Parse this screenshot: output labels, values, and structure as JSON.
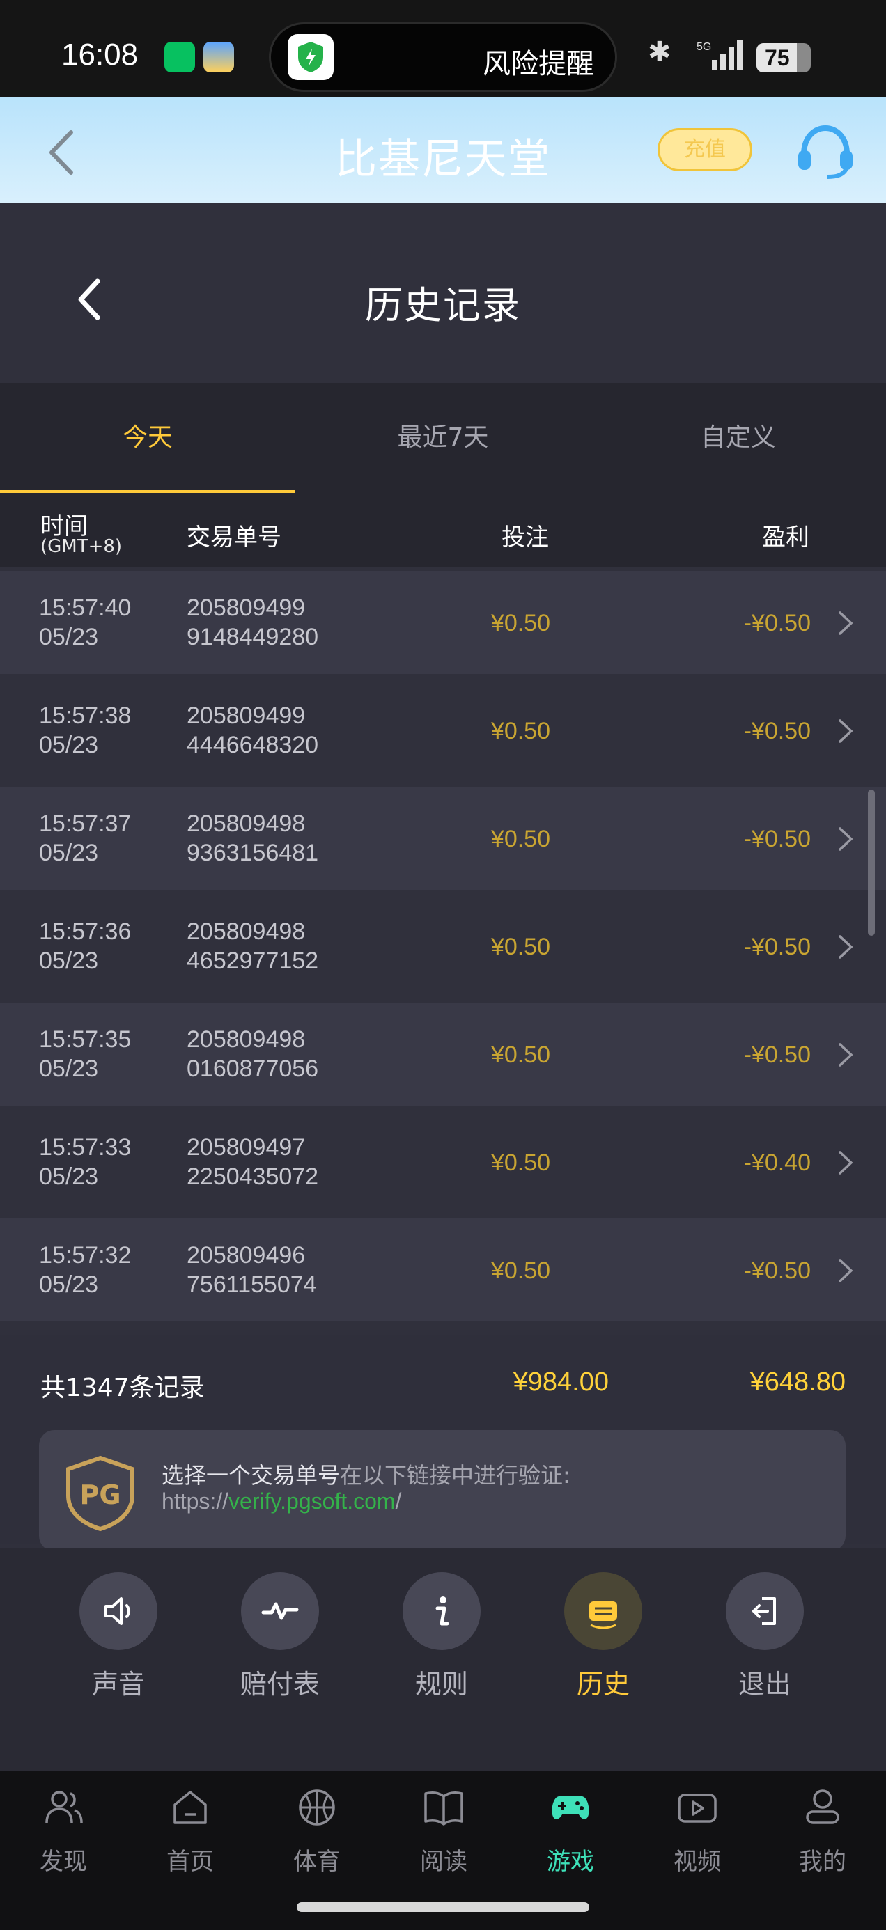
{
  "status_bar": {
    "time": "16:08",
    "risk_label": "风险提醒",
    "network": "5G",
    "battery": "75"
  },
  "header": {
    "title": "比基尼天堂",
    "recharge_label": "充值"
  },
  "history": {
    "title": "历史记录",
    "tabs": [
      "今天",
      "最近7天",
      "自定义"
    ],
    "active_tab": 0,
    "columns": {
      "time": "时间",
      "timezone": "(GMT+8)",
      "txn": "交易单号",
      "bet": "投注",
      "profit": "盈利"
    },
    "rows": [
      {
        "time": "15:57:40",
        "date": "05/23",
        "txn1": "205809499",
        "txn2": "9148449280",
        "bet": "¥0.50",
        "profit": "-¥0.50"
      },
      {
        "time": "15:57:38",
        "date": "05/23",
        "txn1": "205809499",
        "txn2": "4446648320",
        "bet": "¥0.50",
        "profit": "-¥0.50"
      },
      {
        "time": "15:57:37",
        "date": "05/23",
        "txn1": "205809498",
        "txn2": "9363156481",
        "bet": "¥0.50",
        "profit": "-¥0.50"
      },
      {
        "time": "15:57:36",
        "date": "05/23",
        "txn1": "205809498",
        "txn2": "4652977152",
        "bet": "¥0.50",
        "profit": "-¥0.50"
      },
      {
        "time": "15:57:35",
        "date": "05/23",
        "txn1": "205809498",
        "txn2": "0160877056",
        "bet": "¥0.50",
        "profit": "-¥0.50"
      },
      {
        "time": "15:57:33",
        "date": "05/23",
        "txn1": "205809497",
        "txn2": "2250435072",
        "bet": "¥0.50",
        "profit": "-¥0.40"
      },
      {
        "time": "15:57:32",
        "date": "05/23",
        "txn1": "205809496",
        "txn2": "7561155074",
        "bet": "¥0.50",
        "profit": "-¥0.50"
      }
    ],
    "totals": {
      "count_label": "共1347条记录",
      "bet": "¥984.00",
      "profit": "¥648.80"
    },
    "verify": {
      "highlight": "选择一个交易单号",
      "rest": "在以下链接中进行验证:",
      "url_prefix": "https://",
      "url_link": "verify.pgsoft.com",
      "url_suffix": "/"
    }
  },
  "controls": [
    {
      "label": "声音",
      "icon": "speaker-icon"
    },
    {
      "label": "赔付表",
      "icon": "paytable-icon"
    },
    {
      "label": "规则",
      "icon": "info-icon"
    },
    {
      "label": "历史",
      "icon": "history-icon",
      "active": true
    },
    {
      "label": "退出",
      "icon": "exit-icon"
    }
  ],
  "bottom_nav": [
    {
      "label": "发现",
      "icon": "people-icon"
    },
    {
      "label": "首页",
      "icon": "home-icon"
    },
    {
      "label": "体育",
      "icon": "basketball-icon"
    },
    {
      "label": "阅读",
      "icon": "book-icon"
    },
    {
      "label": "游戏",
      "icon": "gamepad-icon",
      "active": true
    },
    {
      "label": "视频",
      "icon": "video-icon"
    },
    {
      "label": "我的",
      "icon": "user-icon"
    }
  ],
  "colors": {
    "accent": "#ffca3a",
    "amount": "#c9a532",
    "link": "#34b24a",
    "nav_active": "#3ee0b8"
  }
}
